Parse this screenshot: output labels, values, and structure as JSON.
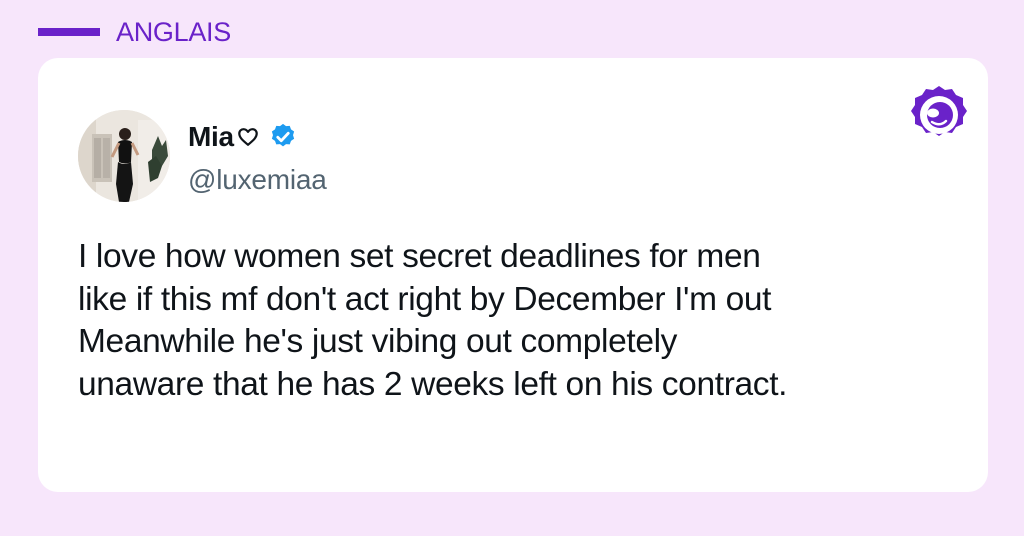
{
  "header": {
    "tag_label": "ANGLAIS"
  },
  "post": {
    "display_name": "Mia",
    "name_emoji_icon": "heart-outline-icon",
    "verified_icon": "verified-badge-icon",
    "handle": "@luxemiaa",
    "text_lines": [
      "I love how women set secret deadlines for men",
      "like if this mf don't act right by December I'm out",
      "Meanwhile he's just vibing out completely",
      "unaware that he has 2 weeks left on his contract."
    ]
  },
  "brand": {
    "logo_icon": "brand-badge-icon"
  },
  "colors": {
    "page_background": "#f7e6fb",
    "accent": "#6a22c9",
    "card_background": "#ffffff",
    "text_primary": "#0f1419",
    "text_secondary": "#536471",
    "verified_blue": "#1d9bf0"
  }
}
